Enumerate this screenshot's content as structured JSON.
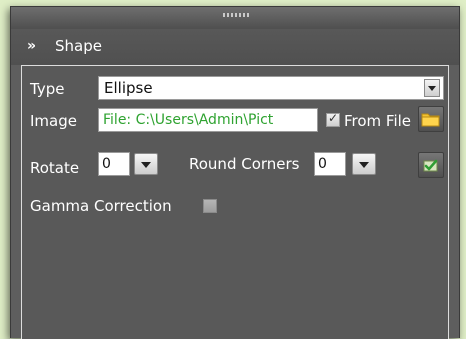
{
  "section": {
    "collapse_icon": "double-chevron-down-icon",
    "title": "Shape"
  },
  "type": {
    "label": "Type",
    "value": "Ellipse"
  },
  "image": {
    "label": "Image",
    "value": "File: C:\\Users\\Admin\\Pict",
    "value_color": "#2fa331",
    "from_file_label": "From File",
    "from_file_checked": true
  },
  "rotate": {
    "label": "Rotate",
    "value": "0"
  },
  "round_corners": {
    "label": "Round Corners",
    "value": "0"
  },
  "gamma": {
    "label": "Gamma Correction",
    "checked": false
  },
  "icons": {
    "browse": "folder-icon",
    "secondary": "image-check-icon"
  }
}
